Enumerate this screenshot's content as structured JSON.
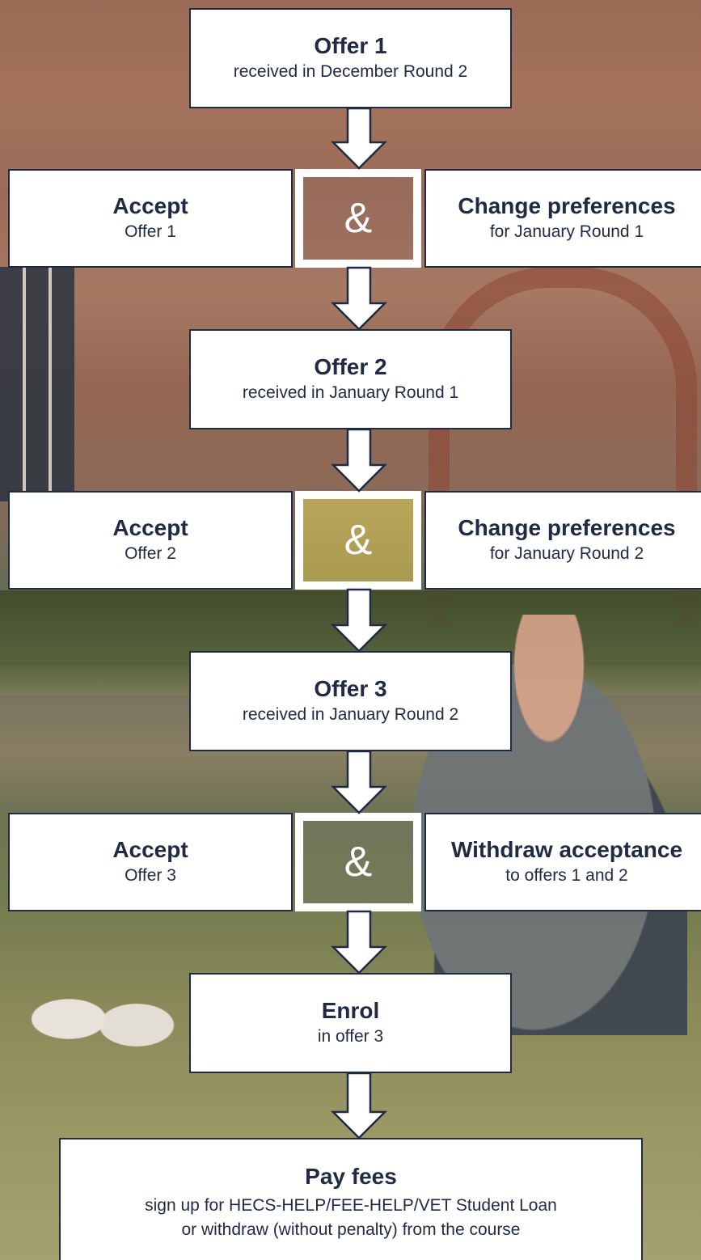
{
  "steps": {
    "offer1": {
      "title": "Offer 1",
      "sub": "received in December Round 2"
    },
    "accept1": {
      "title": "Accept",
      "sub": "Offer 1"
    },
    "change1": {
      "title": "Change preferences",
      "sub": "for January Round 1"
    },
    "offer2": {
      "title": "Offer 2",
      "sub": "received in January Round 1"
    },
    "accept2": {
      "title": "Accept",
      "sub": "Offer 2"
    },
    "change2": {
      "title": "Change preferences",
      "sub": "for January Round 2"
    },
    "offer3": {
      "title": "Offer 3",
      "sub": "received in January Round 2"
    },
    "accept3": {
      "title": "Accept",
      "sub": "Offer 3"
    },
    "withdraw": {
      "title": "Withdraw acceptance",
      "sub": "to offers 1 and 2"
    },
    "enrol": {
      "title": "Enrol",
      "sub": "in offer 3"
    },
    "pay": {
      "title": "Pay fees",
      "sub1": "sign up for HECS-HELP/FEE-HELP/VET Student Loan",
      "sub2": "or withdraw (without penalty) from the course"
    }
  },
  "connector": {
    "symbol": "&"
  },
  "colors": {
    "box_border": "#1f2a44",
    "text": "#1f2a44",
    "arrow_fill": "#ffffff"
  }
}
